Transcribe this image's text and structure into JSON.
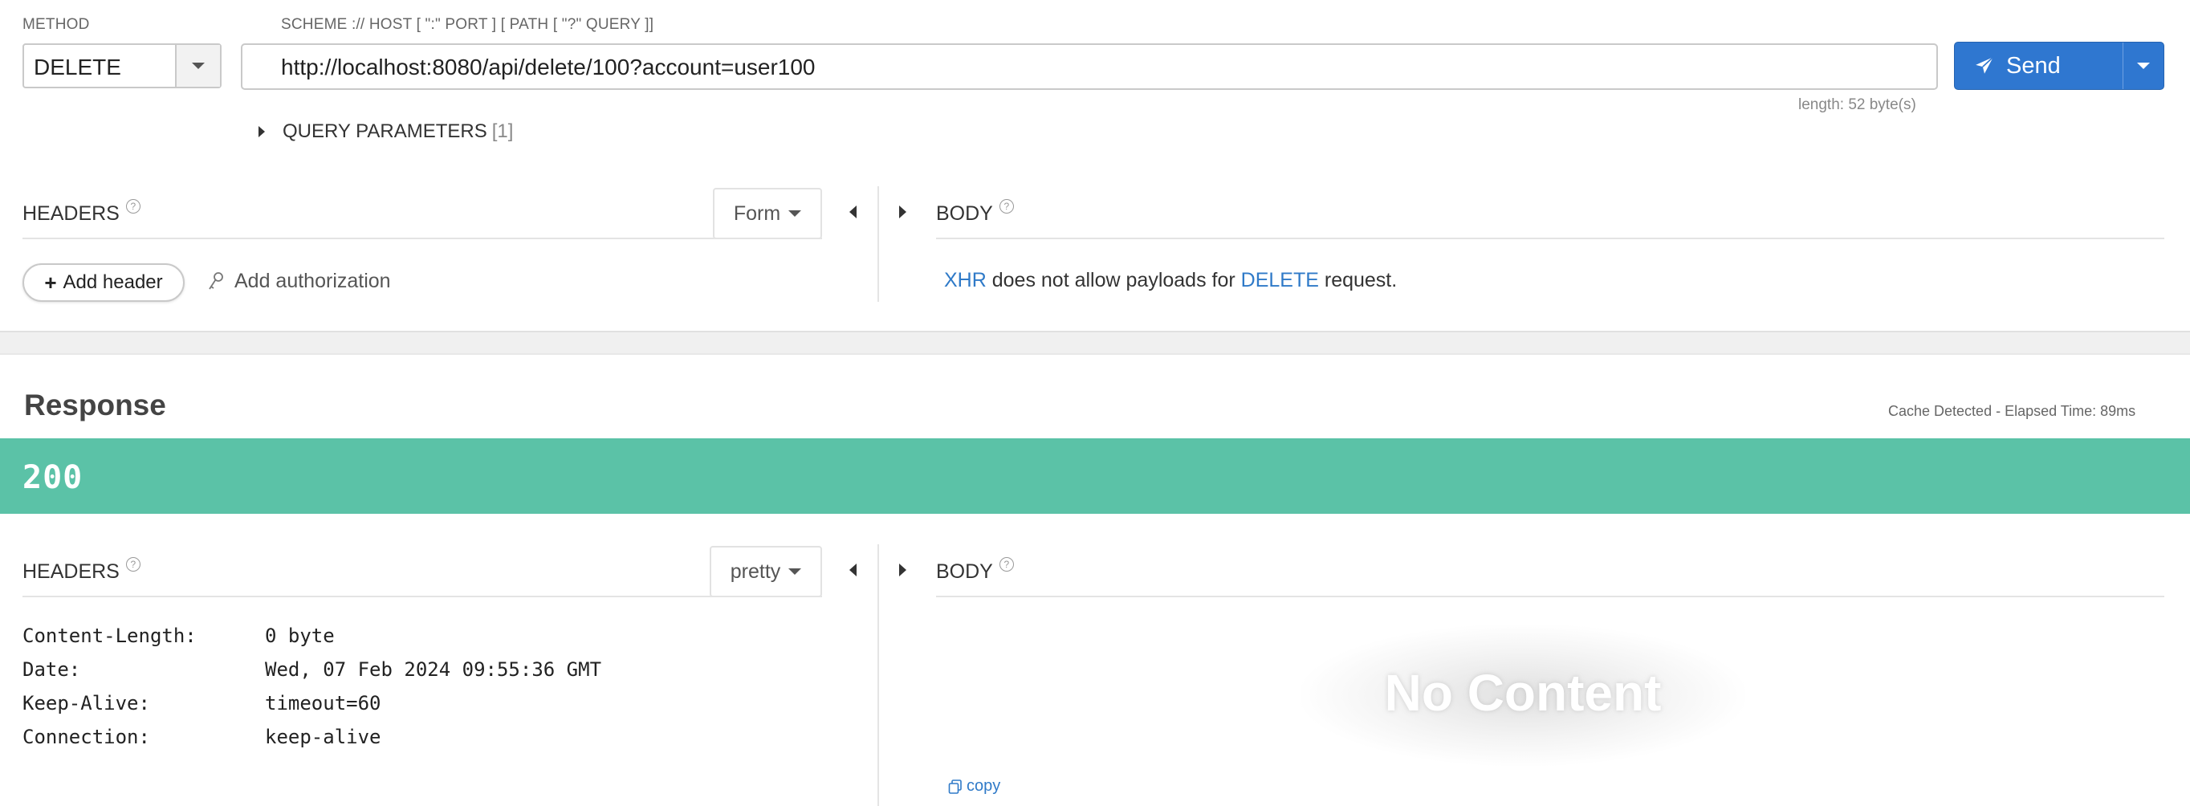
{
  "request": {
    "method_label": "METHOD",
    "method_value": "DELETE",
    "url_label": "SCHEME :// HOST [ \":\" PORT ] [ PATH [ \"?\" QUERY ]]",
    "url_value": "http://localhost:8080/api/delete/100?account=user100",
    "send_label": "Send",
    "length_text": "length: 52 byte(s)",
    "query_params_label": "QUERY PARAMETERS",
    "query_params_count": "[1]",
    "headers_title": "HEADERS",
    "headers_format": "Form",
    "body_title": "BODY",
    "add_header_label": "Add header",
    "add_authorization_label": "Add authorization",
    "body_message": {
      "part1": "XHR",
      "part2": " does not allow payloads for ",
      "part3": "DELETE",
      "part4": " request."
    }
  },
  "response": {
    "title": "Response",
    "cache_elapsed": "Cache Detected - Elapsed Time: 89ms",
    "status_code": "200",
    "status_color": "#5bc2a7",
    "headers_title": "HEADERS",
    "headers_format": "pretty",
    "body_title": "BODY",
    "headers": [
      {
        "key": "Content-Length:",
        "value": "0 byte"
      },
      {
        "key": "Date:",
        "value": "Wed, 07 Feb 2024 09:55:36 GMT"
      },
      {
        "key": "Keep-Alive:",
        "value": "timeout=60"
      },
      {
        "key": "Connection:",
        "value": "keep-alive"
      }
    ],
    "no_content_label": "No Content",
    "copy_label": "copy"
  },
  "icons": {
    "send": "paper-plane-icon",
    "auth": "key-icon",
    "copy": "copy-icon",
    "help": "help-circle-icon"
  },
  "colors": {
    "accent": "#2f77d0",
    "link": "#2f7ac8"
  }
}
